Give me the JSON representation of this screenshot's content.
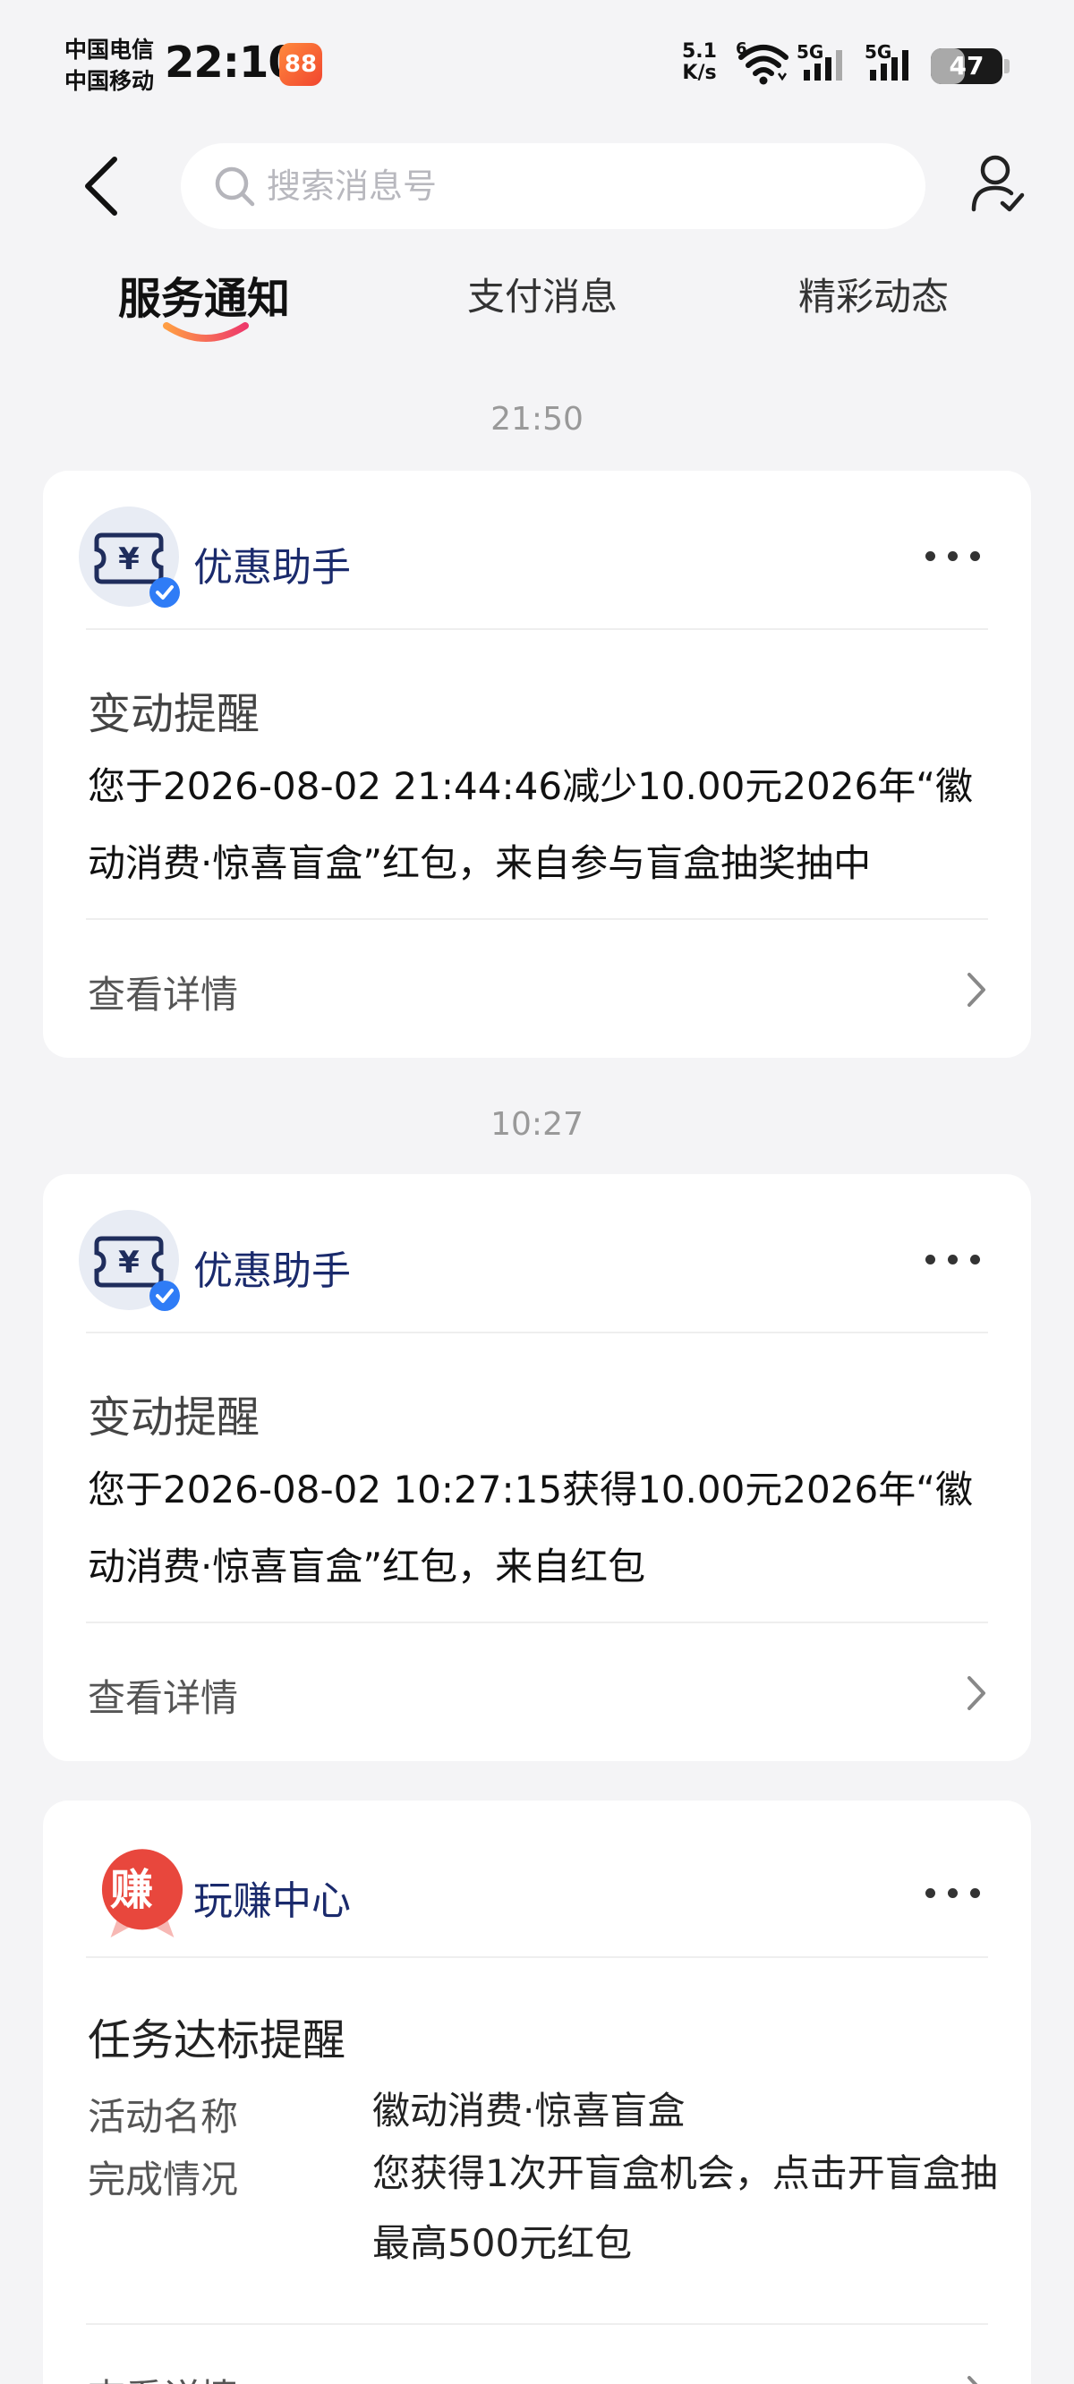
{
  "status_bar": {
    "carrier_1": "中国电信",
    "carrier_2": "中国移动",
    "time": "22:10",
    "app_badge": "88",
    "net_speed_value": "5.1",
    "net_speed_unit": "K/s",
    "wifi_tag": "6",
    "signal_1_label": "5G",
    "signal_2_label": "5G",
    "battery_level": "47",
    "battery_fraction": 0.47
  },
  "header": {
    "search_placeholder": "搜索消息号",
    "icons": {
      "back": "back-arrow-icon",
      "search": "search-icon",
      "contacts": "contacts-icon"
    }
  },
  "tabs": [
    {
      "label": "服务通知",
      "active": true
    },
    {
      "label": "支付消息",
      "active": false
    },
    {
      "label": "精彩动态",
      "active": false
    }
  ],
  "accent_colors": {
    "tab_underline_start": "#ff9e44",
    "tab_underline_end": "#ee3a6b",
    "sender_blue": "#1a2a6c",
    "verified_blue": "#2f7cf6",
    "earn_red": "#e8473d"
  },
  "messages": [
    {
      "timestamp": "21:50",
      "sender": "优惠助手",
      "title": "变动提醒",
      "body": "您于2026-08-02 21:44:46减少10.00元2026年“徽动消费·惊喜盲盒”红包，来自参与盲盒抽奖抽中",
      "detail": "查看详情"
    },
    {
      "timestamp": "10:27",
      "sender": "优惠助手",
      "title": "变动提醒",
      "body": "您于2026-08-02 10:27:15获得10.00元2026年“徽动消费·惊喜盲盒”红包，来自红包",
      "detail": "查看详情"
    }
  ],
  "task_card": {
    "sender": "玩赚中心",
    "avatar_char": "赚",
    "title": "任务达标提醒",
    "rows": [
      {
        "label": "活动名称",
        "value": "徽动消费·惊喜盲盒"
      },
      {
        "label": "完成情况",
        "value": "您获得1次开盲盒机会，点击开盲盒抽最高500元红包"
      }
    ],
    "detail": "查看详情"
  }
}
